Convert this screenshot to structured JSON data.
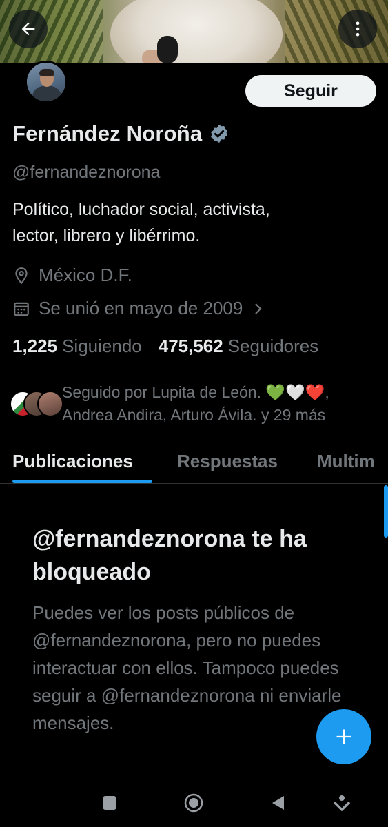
{
  "profile": {
    "name": "Fernández Noroña",
    "handle": "@fernandeznorona",
    "bio_line1": "Político, luchador social, activista,",
    "bio_line2": "lector, librero y libérrimo.",
    "location": "México D.F.",
    "joined": "Se unió en mayo de 2009",
    "following_count": "1,225",
    "following_label": "Siguiendo",
    "followers_count": "475,562",
    "followers_label": "Seguidores",
    "followed_by_line1": "Seguido por Lupita de León. 💚🤍❤️,",
    "followed_by_line2": "Andrea Andira, Arturo Ávila. y 29 más"
  },
  "actions": {
    "follow_label": "Seguir"
  },
  "tabs": [
    {
      "label": "Publicaciones",
      "active": true
    },
    {
      "label": "Respuestas",
      "active": false
    },
    {
      "label": "Multim",
      "active": false
    }
  ],
  "blocked": {
    "title": "@fernandeznorona te ha bloqueado",
    "body": "Puedes ver los posts públicos de @fernandeznorona, pero no puedes interactuar con ellos. Tampoco puedes seguir a @fernandeznorona ni enviarle mensajes."
  },
  "colors": {
    "accent": "#1d9bf0",
    "background": "#000000",
    "text_primary": "#e7e9ea",
    "text_secondary": "#71767b",
    "verified_badge": "#829aab"
  },
  "icons": {
    "back": "arrow-left-icon",
    "more": "more-vertical-icon",
    "verified": "verified-badge-icon",
    "location": "location-pin-icon",
    "calendar": "calendar-icon",
    "chevron": "chevron-right-icon",
    "compose": "plus-icon",
    "nav_square": "recent-apps-icon",
    "nav_home": "home-circle-icon",
    "nav_back": "back-triangle-icon",
    "nav_extra": "chevron-down-icon"
  }
}
